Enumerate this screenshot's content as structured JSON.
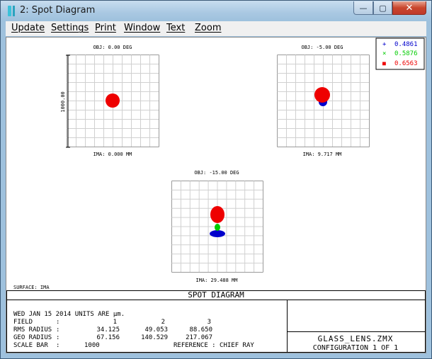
{
  "window": {
    "title": "2: Spot Diagram",
    "controls": {
      "minimize": "—",
      "maximize": "▢",
      "close": "✕"
    }
  },
  "menu": {
    "items": [
      {
        "id": "update",
        "label": "Update"
      },
      {
        "id": "settings",
        "label": "Settings"
      },
      {
        "id": "print",
        "label": "Print"
      },
      {
        "id": "window",
        "label": "Window"
      },
      {
        "id": "text",
        "label": "Text"
      },
      {
        "id": "zoom",
        "label": "Zoom"
      }
    ]
  },
  "legend": {
    "items": [
      {
        "marker": "+",
        "value": "0.4861",
        "color": "#0000cc"
      },
      {
        "marker": "×",
        "value": "0.5876",
        "color": "#00cc00"
      },
      {
        "marker": "■",
        "value": "0.6563",
        "color": "#ee0000"
      }
    ]
  },
  "plots": {
    "p1": {
      "obj": "OBJ: 0.00 DEG",
      "ima": "IMA: 0.000 MM",
      "scale_label": "1000.00"
    },
    "p2": {
      "obj": "OBJ: -5.00 DEG",
      "ima": "IMA: 9.717 MM"
    },
    "p3": {
      "obj": "OBJ: -15.00 DEG",
      "ima": "IMA: 29.488 MM"
    }
  },
  "surface": "SURFACE: IMA",
  "footer": {
    "heading": "SPOT DIAGRAM",
    "date_line": "WED JAN 15 2014   UNITS ARE µm.",
    "field_label": "FIELD",
    "field_values": [
      "1",
      "2",
      "3"
    ],
    "rms_label": "RMS RADIUS",
    "rms_values": [
      "34.125",
      "49.053",
      "88.650"
    ],
    "geo_label": "GEO RADIUS",
    "geo_values": [
      "67.156",
      "140.529",
      "217.067"
    ],
    "scale_label": "SCALE BAR",
    "scale_value": "1000",
    "reference": "REFERENCE  : CHIEF RAY",
    "file_name": "GLASS_LENS.ZMX",
    "configuration": "CONFIGURATION 1 OF 1"
  }
}
